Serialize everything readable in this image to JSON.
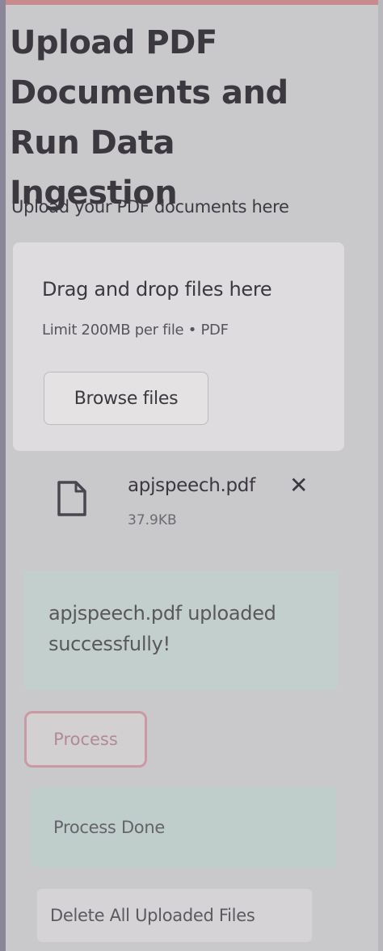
{
  "page": {
    "title": "Upload PDF Documents and Run Data Ingestion"
  },
  "uploader": {
    "label": "Upload your PDF documents here",
    "drop_title": "Drag and drop files here",
    "limit_text": "Limit 200MB per file • PDF",
    "browse_label": "Browse files"
  },
  "uploaded_file": {
    "name": "apjspeech.pdf",
    "size": "37.9KB",
    "icon": "file-icon",
    "remove_icon": "close-icon"
  },
  "messages": {
    "upload_success": "apjspeech.pdf uploaded successfully!",
    "process_done": "Process Done"
  },
  "actions": {
    "process_label": "Process",
    "delete_all_label": "Delete All Uploaded Files"
  },
  "colors": {
    "accent": "#c98a8e",
    "success_bg": "#c3cfcc",
    "process_border": "#c99aa4"
  }
}
